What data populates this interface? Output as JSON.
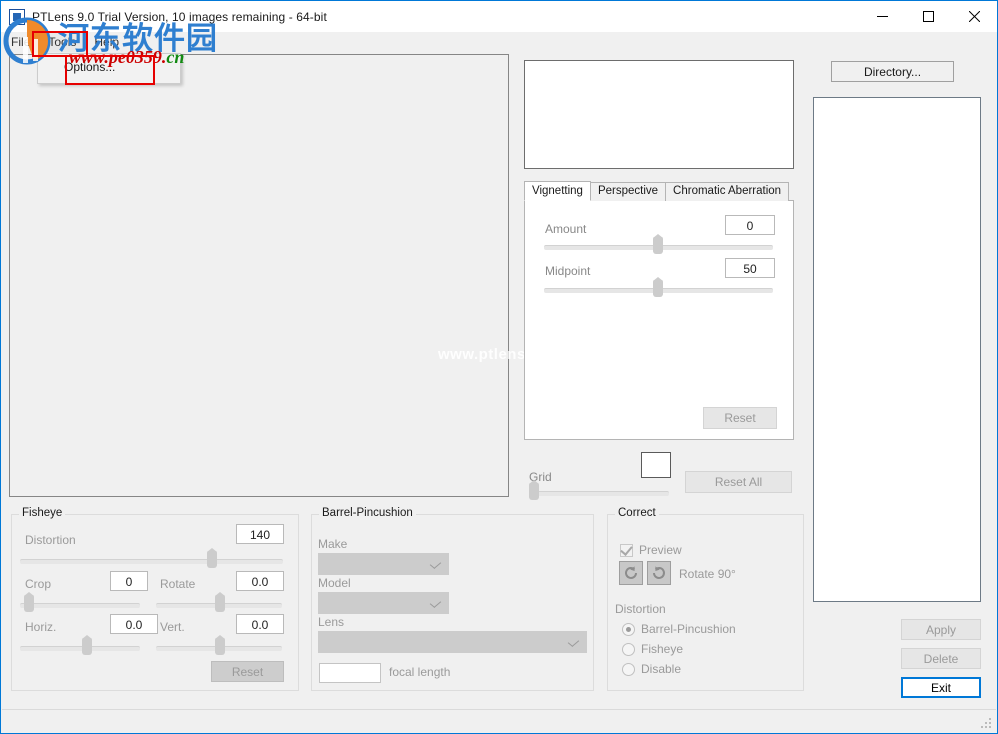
{
  "window": {
    "title": "PTLens 9.0 Trial Version, 10 images remaining - 64-bit",
    "app_icon": "ptlens-app-icon",
    "minimize": "—",
    "maximize": "☐",
    "close": "✕",
    "accent_color": "#0078d7",
    "chrome_color": "#f0f0f0"
  },
  "menubar": {
    "items": [
      {
        "label": "File"
      },
      {
        "label": "Tools"
      },
      {
        "label": "Help"
      }
    ],
    "open_menu": "Tools"
  },
  "tools_menu": {
    "items": [
      {
        "label": "Options..."
      }
    ]
  },
  "annotations": {
    "highlight_color": "#e60000",
    "boxes": [
      {
        "target": "Tools"
      },
      {
        "target": "Options..."
      }
    ]
  },
  "directory": {
    "button_label": "Directory...",
    "list_items": []
  },
  "adjust_tabs": {
    "tabs": [
      {
        "label": "Vignetting",
        "active": true
      },
      {
        "label": "Perspective",
        "active": false
      },
      {
        "label": "Chromatic Aberration",
        "active": false
      }
    ],
    "vignetting": {
      "amount_label": "Amount",
      "amount_value": "0",
      "midpoint_label": "Midpoint",
      "midpoint_value": "50",
      "reset_label": "Reset"
    }
  },
  "grid": {
    "label": "Grid",
    "value": 0,
    "swatch_color": "#ffffff",
    "reset_all_label": "Reset All"
  },
  "fisheye": {
    "title": "Fisheye",
    "distortion_label": "Distortion",
    "distortion_value": "140",
    "crop_label": "Crop",
    "crop_value": "0",
    "rotate_label": "Rotate",
    "rotate_value": "0.0",
    "horiz_label": "Horiz.",
    "horiz_value": "0.0",
    "vert_label": "Vert.",
    "vert_value": "0.0",
    "reset_label": "Reset"
  },
  "barrel": {
    "title": "Barrel-Pincushion",
    "make_label": "Make",
    "make_value": "",
    "model_label": "Model",
    "model_value": "",
    "lens_label": "Lens",
    "lens_value": "",
    "focal_length_value": "",
    "focal_length_label": "focal length"
  },
  "correct": {
    "title": "Correct",
    "preview_label": "Preview",
    "preview_checked": true,
    "rotate_ccw_icon": "rotate-counterclockwise-icon",
    "rotate_cw_icon": "rotate-clockwise-icon",
    "rotate_label": "Rotate 90°",
    "distortion_label": "Distortion",
    "options": [
      {
        "label": "Barrel-Pincushion",
        "selected": true
      },
      {
        "label": "Fisheye",
        "selected": false
      },
      {
        "label": "Disable",
        "selected": false
      }
    ]
  },
  "actions": {
    "apply_label": "Apply",
    "apply_enabled": false,
    "delete_label": "Delete",
    "delete_enabled": false,
    "exit_label": "Exit",
    "exit_default": true
  },
  "watermarks": {
    "site_cn": "河东软件园",
    "site_url_main": "www.pe0359.",
    "site_url_tld": "cn",
    "center_text": "www.ptlens.NET"
  },
  "statusbar": {
    "text": ""
  }
}
